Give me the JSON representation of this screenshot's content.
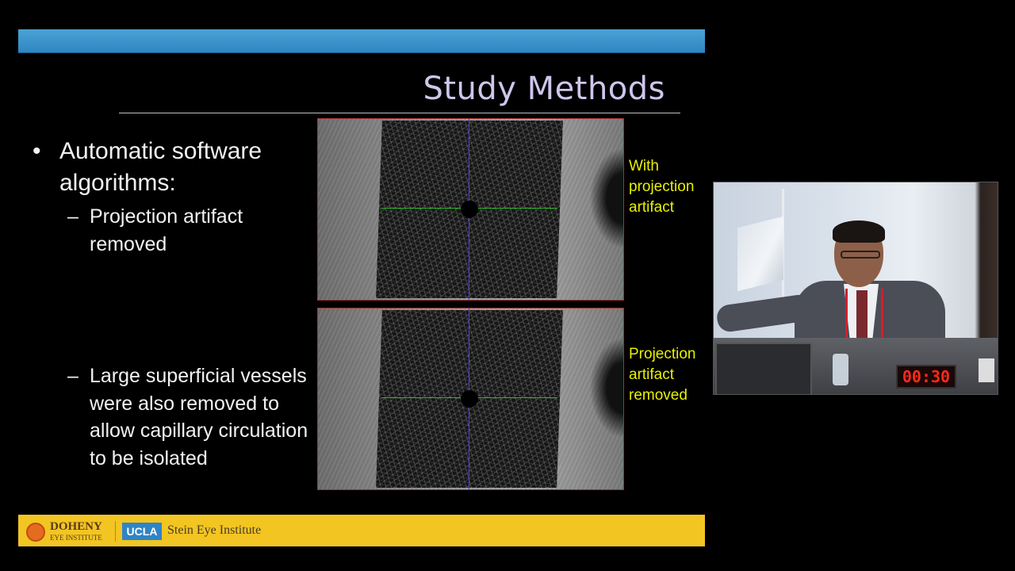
{
  "slide": {
    "title": "Study Methods",
    "bullet": {
      "symbol": "•",
      "text": "Automatic software algorithms:"
    },
    "sub_bullets": [
      {
        "symbol": "–",
        "text": "Projection artifact removed"
      },
      {
        "symbol": "–",
        "text": "Large superficial vessels were also removed to allow capillary circulation to be isolated"
      }
    ],
    "captions": [
      "With projection artifact",
      "Projection artifact removed"
    ],
    "footer": {
      "doheny_big": "DOHENY",
      "doheny_small": "EYE INSTITUTE",
      "ucla": "UCLA",
      "stein": "Stein Eye Institute"
    }
  },
  "video": {
    "timer": "00:30"
  },
  "colors": {
    "title": "#cfc6ec",
    "caption": "#e8f000",
    "top_bar": "#3d96cf",
    "footer_bar": "#f2c522",
    "timer": "#ff2a1a"
  }
}
